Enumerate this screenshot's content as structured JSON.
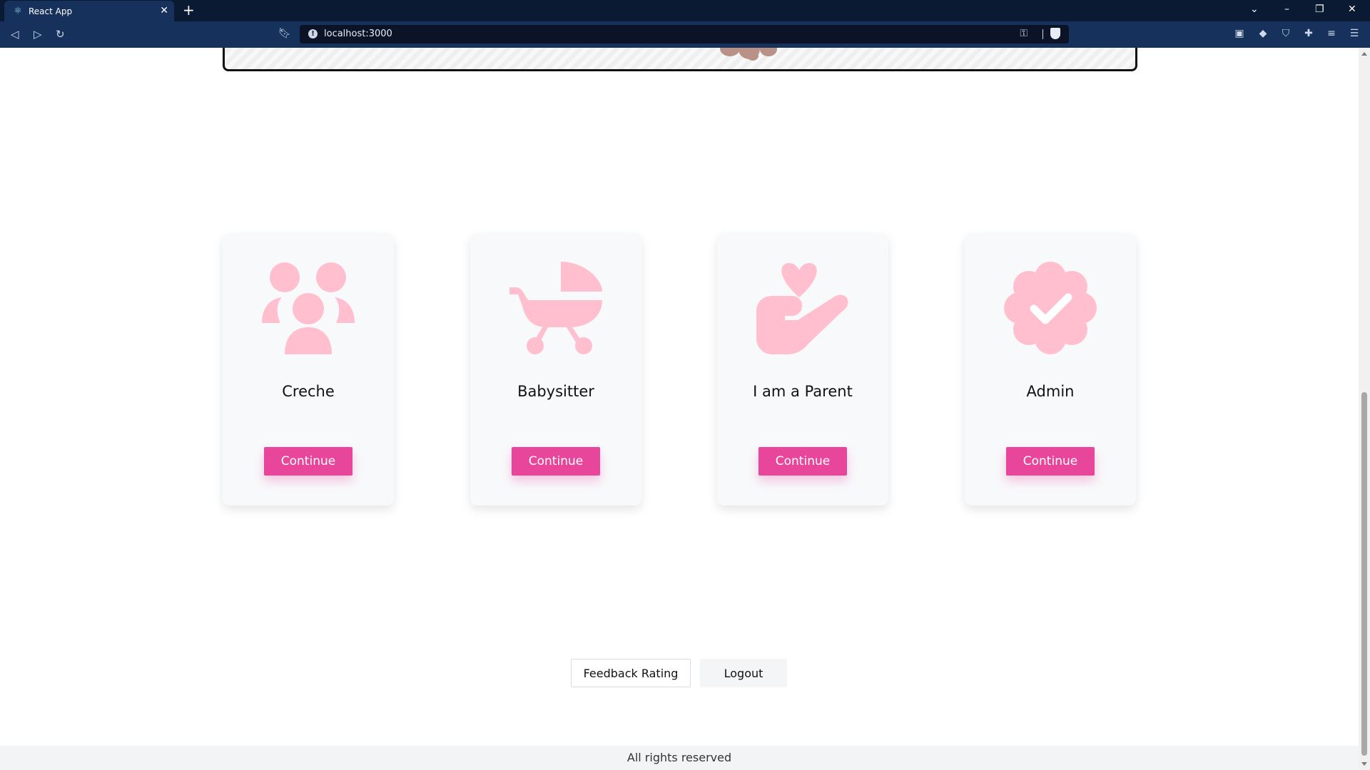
{
  "browser": {
    "tab_title": "React App",
    "tab_close": "✕",
    "new_tab": "+",
    "url": "localhost:3000",
    "window_controls": {
      "list": "⌄",
      "minimize": "–",
      "restore": "❐",
      "close": "✕"
    }
  },
  "cards": [
    {
      "title": "Creche",
      "button": "Continue",
      "icon": "children-group-icon"
    },
    {
      "title": "Babysitter",
      "button": "Continue",
      "icon": "baby-stroller-icon"
    },
    {
      "title": "I am a Parent",
      "button": "Continue",
      "icon": "hand-heart-icon"
    },
    {
      "title": "Admin",
      "button": "Continue",
      "icon": "verified-badge-icon"
    }
  ],
  "actions": {
    "feedback": "Feedback Rating",
    "logout": "Logout"
  },
  "footer": {
    "text": "All rights reserved"
  },
  "colors": {
    "accent": "#e8469b",
    "icon_pink": "#ffbfcf",
    "chrome_dark": "#0b1a33",
    "chrome": "#16325c"
  }
}
